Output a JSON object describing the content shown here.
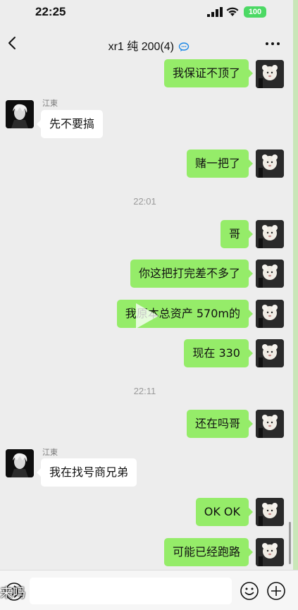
{
  "status_bar": {
    "time": "22:25",
    "battery": "100"
  },
  "header": {
    "title": "xr1 纯 200(4)"
  },
  "messages": [
    {
      "text": "我保证不顶了"
    },
    {
      "sender": "江東",
      "text": "先不要搞"
    },
    {
      "text": "赌一把了"
    },
    {
      "timestamp": "22:01"
    },
    {
      "text": "哥"
    },
    {
      "text": "你这把打完差不多了"
    },
    {
      "text": "我原本总资产 570m的"
    },
    {
      "text": "现在 330"
    },
    {
      "timestamp": "22:11"
    },
    {
      "text": "还在吗哥"
    },
    {
      "sender": "江東",
      "text": "我在找号商兄弟"
    },
    {
      "text": "OK OK"
    },
    {
      "text": "可能已经跑路"
    }
  ],
  "input_bar": {
    "overlay_text": "来吗"
  },
  "colors": {
    "self_bubble": "#95ec69",
    "other_bubble": "#ffffff",
    "background": "#ededed"
  }
}
